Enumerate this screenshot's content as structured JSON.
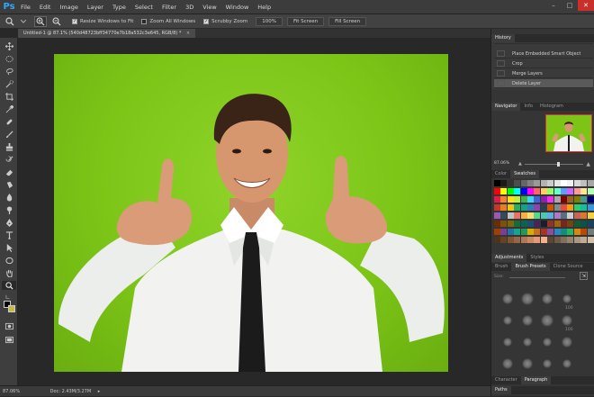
{
  "app": {
    "logo": "Ps"
  },
  "menus": [
    "File",
    "Edit",
    "Image",
    "Layer",
    "Type",
    "Select",
    "Filter",
    "3D",
    "View",
    "Window",
    "Help"
  ],
  "window_controls": [
    "–",
    "□",
    "✕"
  ],
  "options_bar": {
    "resize_windows": {
      "label": "Resize Windows to Fit",
      "checked": true
    },
    "zoom_all": {
      "label": "Zoom All Windows",
      "checked": false
    },
    "scrubby": {
      "label": "Scrubby Zoom",
      "checked": true
    },
    "btn_100": "100%",
    "btn_fit": "Fit Screen",
    "btn_fill": "Fill Screen"
  },
  "document": {
    "tab_label": "Untitled-1 @ 87.1% (540d48723bff34770e7b18a532c3e645, RGB/8) *",
    "close": "×"
  },
  "status": {
    "zoom": "87.06%",
    "doc": "Doc: 2.43M/3.27M",
    "arrow": "▸"
  },
  "history": {
    "tab": "History",
    "items": [
      {
        "label": "Place Embedded Smart Object",
        "selected": false
      },
      {
        "label": "Crop",
        "selected": false
      },
      {
        "label": "Merge Layers",
        "selected": false
      },
      {
        "label": "Delete Layer",
        "selected": true
      }
    ]
  },
  "navigator": {
    "tabs": [
      "Navigator",
      "Info",
      "Histogram"
    ],
    "zoom": "87.06%"
  },
  "swatches": {
    "tabs": [
      "Color",
      "Swatches"
    ]
  },
  "adjustments": {
    "tabs": [
      "Adjustments",
      "Styles"
    ]
  },
  "brush_panel": {
    "tabs": [
      "Brush",
      "Brush Presets",
      "Clone Source"
    ],
    "size_label": "Size:",
    "sizes": [
      "",
      "",
      "",
      "100",
      "",
      "",
      "",
      "100",
      "",
      "",
      "",
      "",
      "",
      "",
      "",
      ""
    ]
  },
  "bottom_tabs": {
    "row1": [
      "Character",
      "Paragraph"
    ],
    "row2": [
      "Paths"
    ]
  },
  "colors": {
    "accent": "#31a8ff",
    "canvas_green": "#7cc517",
    "panel": "#353535"
  },
  "icons": [
    "zoom-tool-icon",
    "zoom-in-icon",
    "zoom-out-icon",
    "move-icon",
    "marquee-icon",
    "lasso-icon",
    "quick-select-icon",
    "crop-icon",
    "eyedropper-icon",
    "healing-icon",
    "brush-icon",
    "stamp-icon",
    "history-brush-icon",
    "eraser-icon",
    "gradient-icon",
    "blur-icon",
    "dodge-icon",
    "pen-icon",
    "type-icon",
    "path-select-icon",
    "shape-icon",
    "hand-icon",
    "zoom-icon",
    "swap-colors-icon",
    "quick-mask-icon",
    "screen-mode-icon"
  ]
}
